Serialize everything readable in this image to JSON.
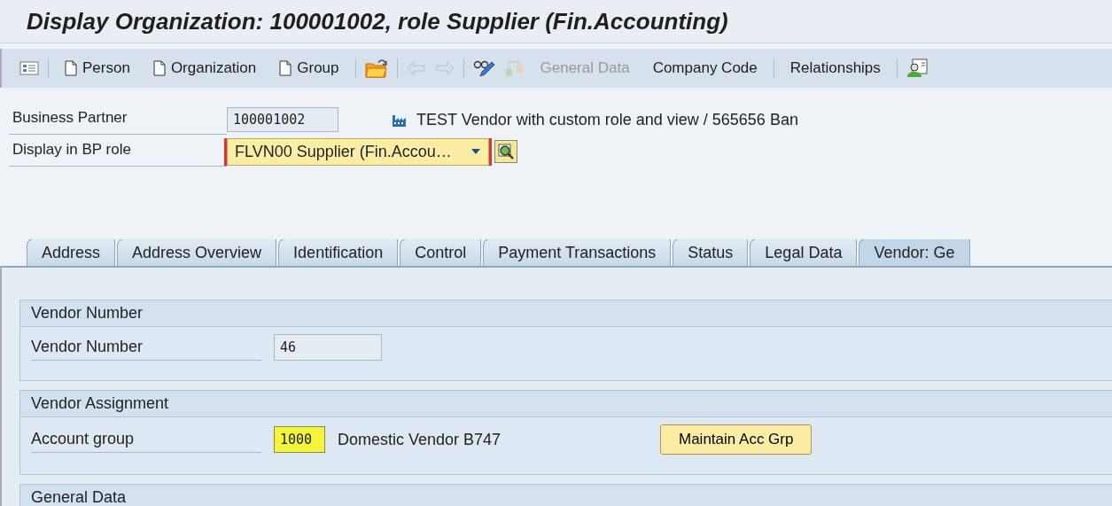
{
  "window": {
    "title": "Display Organization: 100001002, role Supplier (Fin.Accounting)"
  },
  "toolbar": [
    {
      "kind": "list",
      "disabled": false
    },
    {
      "kind": "separator"
    },
    {
      "kind": "page",
      "label": "Person",
      "disabled": false
    },
    {
      "kind": "page",
      "label": "Organization",
      "disabled": false
    },
    {
      "kind": "page",
      "label": "Group",
      "disabled": false
    },
    {
      "kind": "separator"
    },
    {
      "kind": "folder",
      "disabled": false
    },
    {
      "kind": "separator"
    },
    {
      "kind": "back",
      "disabled": true
    },
    {
      "kind": "forward",
      "disabled": true
    },
    {
      "kind": "separator"
    },
    {
      "kind": "edit",
      "disabled": false
    },
    {
      "kind": "hierarchy",
      "disabled": true
    },
    {
      "kind": "button",
      "label": "General Data",
      "disabled": true
    },
    {
      "kind": "button",
      "label": "Company Code",
      "disabled": false
    },
    {
      "kind": "separator"
    },
    {
      "kind": "button",
      "label": "Relationships",
      "disabled": false
    },
    {
      "kind": "separator"
    },
    {
      "kind": "card",
      "disabled": false
    }
  ],
  "header": {
    "business_partner": {
      "label": "Business Partner",
      "value": "100001002",
      "description": "TEST Vendor with custom role and view / 565656 Ban"
    },
    "bp_role": {
      "label": "Display in BP role",
      "value": "FLVN00 Supplier (Fin.Accou…",
      "required": true
    }
  },
  "tabs": [
    {
      "label": "Address",
      "selected": false
    },
    {
      "label": "Address Overview",
      "selected": false
    },
    {
      "label": "Identification",
      "selected": false
    },
    {
      "label": "Control",
      "selected": false
    },
    {
      "label": "Payment Transactions",
      "selected": false
    },
    {
      "label": "Status",
      "selected": false
    },
    {
      "label": "Legal Data",
      "selected": false
    },
    {
      "label": "Vendor: Ge",
      "selected": true
    }
  ],
  "sections": [
    {
      "title": "Vendor Number",
      "fields": [
        {
          "label": "Vendor Number",
          "value": "46",
          "highlighted": false
        }
      ]
    },
    {
      "title": "Vendor Assignment",
      "fields": [
        {
          "label": "Account group",
          "value": "1000",
          "highlighted": true,
          "description": "Domestic Vendor B747",
          "button": "Maintain Acc Grp"
        }
      ]
    },
    {
      "title": "General Data"
    }
  ]
}
